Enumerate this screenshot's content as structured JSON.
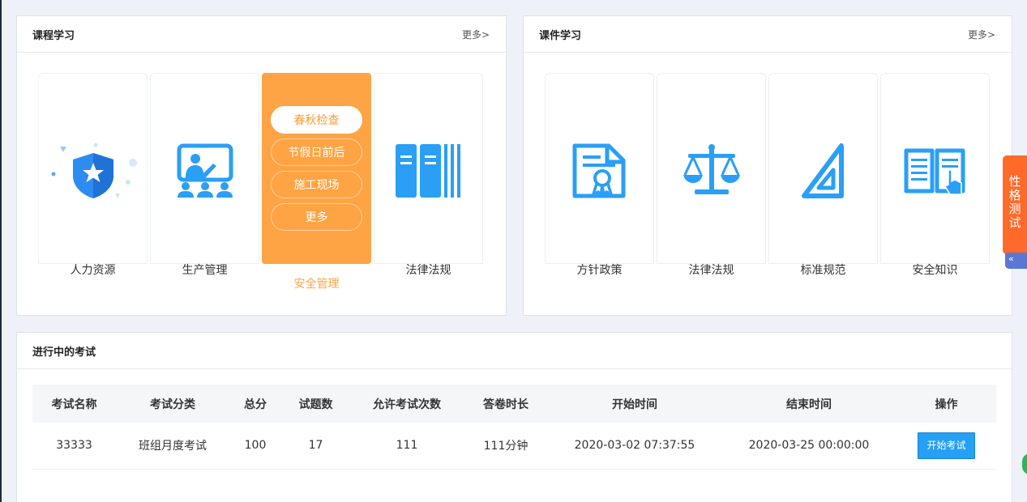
{
  "course_panel": {
    "title": "课程学习",
    "more": "更多>",
    "cards": [
      {
        "label": "人力资源",
        "icon": "hr-shield-icon"
      },
      {
        "label": "生产管理",
        "icon": "teaching-board-icon"
      },
      {
        "label": "安全管理",
        "icon": "safety-icon",
        "active": true,
        "sub_items": [
          "春秋检查",
          "节假日前后",
          "施工现场",
          "更多"
        ],
        "selected_sub": "春秋检查"
      },
      {
        "label": "法律法规",
        "icon": "books-icon"
      }
    ]
  },
  "courseware_panel": {
    "title": "课件学习",
    "more": "更多>",
    "cards": [
      {
        "label": "方针政策",
        "icon": "certificate-icon"
      },
      {
        "label": "法律法规",
        "icon": "scales-icon"
      },
      {
        "label": "标准规范",
        "icon": "triangle-ruler-icon"
      },
      {
        "label": "安全知识",
        "icon": "open-book-icon"
      }
    ]
  },
  "side_tab": {
    "label": "性格测试",
    "fold": "«"
  },
  "exam_panel": {
    "title": "进行中的考试",
    "columns": [
      "考试名称",
      "考试分类",
      "总分",
      "试题数",
      "允许考试次数",
      "答卷时长",
      "开始时间",
      "结束时间",
      "操作"
    ],
    "rows": [
      {
        "name": "33333",
        "category": "班组月度考试",
        "total": "100",
        "questions": "17",
        "attempts": "111",
        "duration": "111分钟",
        "start": "2020-03-02 07:37:55",
        "end": "2020-03-25 00:00:00",
        "action": "开始考试"
      }
    ]
  },
  "colors": {
    "accent_orange": "#ffa444",
    "icon_blue": "#2a9ff5",
    "button_blue": "#26a0f5"
  }
}
